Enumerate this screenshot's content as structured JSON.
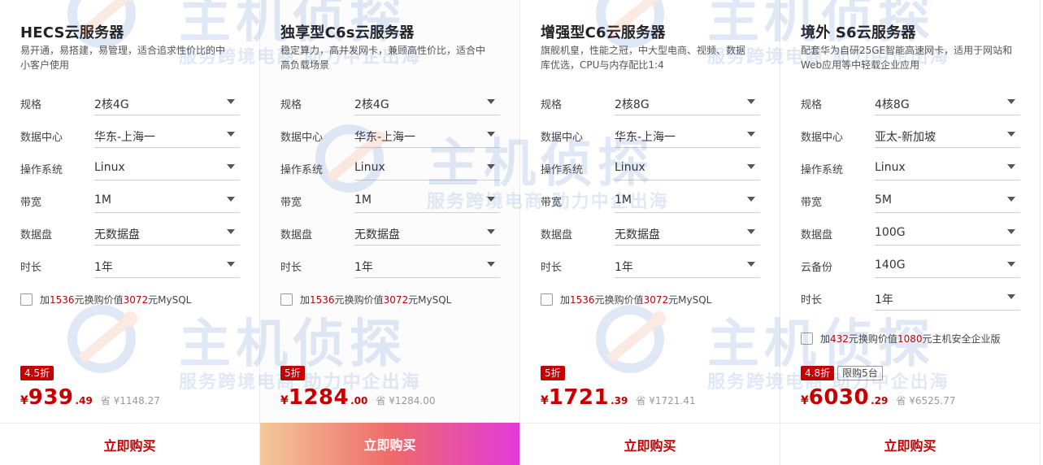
{
  "cards": [
    {
      "title": "HECS云服务器",
      "desc": "易开通，易搭建，易管理，适合追求性价比的中小客户使用",
      "rows": [
        {
          "label": "规格",
          "value": "2核4G"
        },
        {
          "label": "数据中心",
          "value": "华东-上海一"
        },
        {
          "label": "操作系统",
          "value": "Linux"
        },
        {
          "label": "带宽",
          "value": "1M"
        },
        {
          "label": "数据盘",
          "value": "无数据盘"
        },
        {
          "label": "时长",
          "value": "1年"
        }
      ],
      "addon": {
        "p1": "加",
        "n1": "1536",
        "p2": "元换购价值",
        "n2": "3072",
        "p3": "元MySQL"
      },
      "discount": "4.5折",
      "limit": "",
      "currency": "¥",
      "price_int": "939",
      "price_dec": ".49",
      "orig": "省 ¥1148.27",
      "buy": "立即购买"
    },
    {
      "title": "独享型C6s云服务器",
      "desc": "稳定算力，高并发网卡，兼顾高性价比，适合中高负载场景",
      "rows": [
        {
          "label": "规格",
          "value": "2核4G"
        },
        {
          "label": "数据中心",
          "value": "华东-上海一"
        },
        {
          "label": "操作系统",
          "value": "Linux"
        },
        {
          "label": "带宽",
          "value": "1M"
        },
        {
          "label": "数据盘",
          "value": "无数据盘"
        },
        {
          "label": "时长",
          "value": "1年"
        }
      ],
      "addon": {
        "p1": "加",
        "n1": "1536",
        "p2": "元换购价值",
        "n2": "3072",
        "p3": "元MySQL"
      },
      "discount": "5折",
      "limit": "",
      "currency": "¥",
      "price_int": "1284",
      "price_dec": ".00",
      "orig": "省 ¥1284.00",
      "buy": "立即购买"
    },
    {
      "title": "增强型C6云服务器",
      "desc": "旗舰机皇，性能之冠，中大型电商、视频、数据库优选，CPU与内存配比1:4",
      "rows": [
        {
          "label": "规格",
          "value": "2核8G"
        },
        {
          "label": "数据中心",
          "value": "华东-上海一"
        },
        {
          "label": "操作系统",
          "value": "Linux"
        },
        {
          "label": "带宽",
          "value": "1M"
        },
        {
          "label": "数据盘",
          "value": "无数据盘"
        },
        {
          "label": "时长",
          "value": "1年"
        }
      ],
      "addon": {
        "p1": "加",
        "n1": "1536",
        "p2": "元换购价值",
        "n2": "3072",
        "p3": "元MySQL"
      },
      "discount": "5折",
      "limit": "",
      "currency": "¥",
      "price_int": "1721",
      "price_dec": ".39",
      "orig": "省 ¥1721.41",
      "buy": "立即购买"
    },
    {
      "title": "境外 S6云服务器",
      "desc": "配套华为自研25GE智能高速网卡，适用于网站和Web应用等中轻载企业应用",
      "rows": [
        {
          "label": "规格",
          "value": "4核8G"
        },
        {
          "label": "数据中心",
          "value": "亚太-新加坡"
        },
        {
          "label": "操作系统",
          "value": "Linux"
        },
        {
          "label": "带宽",
          "value": "5M"
        },
        {
          "label": "数据盘",
          "value": "100G"
        },
        {
          "label": "云备份",
          "value": "140G"
        },
        {
          "label": "时长",
          "value": "1年"
        }
      ],
      "addon": {
        "p1": "加",
        "n1": "432",
        "p2": "元换购价值",
        "n2": "1080",
        "p3": "元主机安全企业版"
      },
      "discount": "4.8折",
      "limit": "限购5台",
      "currency": "¥",
      "price_int": "6030",
      "price_dec": ".29",
      "orig": "省 ¥6525.77",
      "buy": "立即购买"
    }
  ],
  "watermark": {
    "brand": "主机侦探",
    "slogan": "服务跨境电商 助力中企出海"
  }
}
